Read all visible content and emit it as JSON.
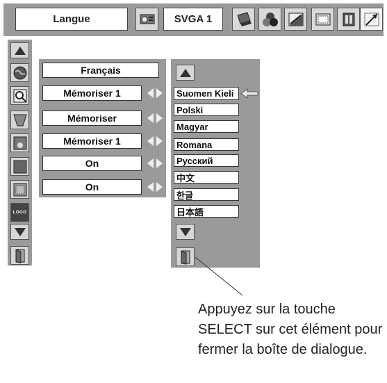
{
  "top_bar": {
    "menu_label": "Langue",
    "input_label": "SVGA 1",
    "icons": [
      "projector-icon",
      "laptop-icon",
      "color-adjust-icon",
      "image-adjust-icon",
      "screen-icon",
      "setting-icon",
      "expand-icon"
    ]
  },
  "side_menu": {
    "icons": [
      "up-arrow-icon",
      "globe-icon",
      "zoom-icon",
      "keystone-icon",
      "lamp-icon",
      "background-icon",
      "display-icon",
      "logo-icon",
      "down-arrow-icon",
      "exit-icon"
    ],
    "logo_text": "LOGO"
  },
  "settings": [
    {
      "value": "Français",
      "arrows": false
    },
    {
      "value": "Mémoriser 1",
      "arrows": true
    },
    {
      "value": "Mémoriser",
      "arrows": true
    },
    {
      "value": "Mémoriser 1",
      "arrows": true
    },
    {
      "value": "On",
      "arrows": true
    },
    {
      "value": "On",
      "arrows": true
    }
  ],
  "languages": {
    "items": [
      "Suomen Kieli",
      "Polski",
      "Magyar",
      "Romana",
      "Русский",
      "中文",
      "한글",
      "日本語"
    ],
    "selected_index": 0
  },
  "annotation": {
    "text": "Appuyez sur la touche SELECT sur cet élément pour fermer la boîte de dialogue."
  }
}
